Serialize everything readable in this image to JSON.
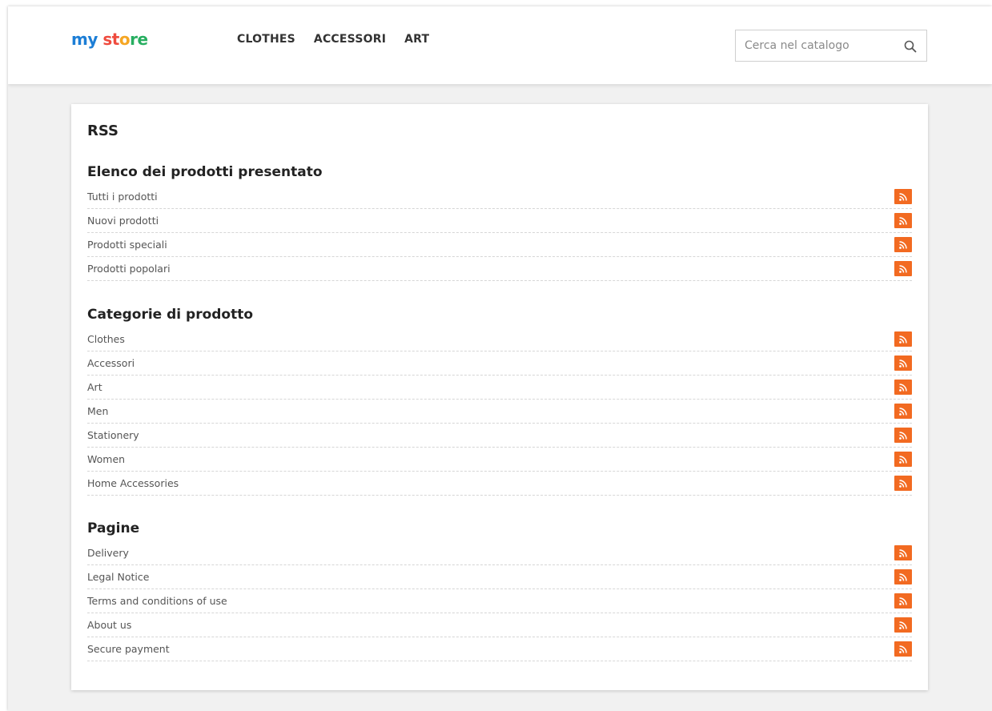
{
  "header": {
    "logo_parts": [
      "my",
      " ",
      "st",
      "o",
      "re"
    ],
    "nav": [
      "CLOTHES",
      "ACCESSORI",
      "ART"
    ],
    "search": {
      "placeholder": "Cerca nel catalogo",
      "icon": "search-icon"
    }
  },
  "page": {
    "title": "RSS",
    "sections": [
      {
        "title": "Elenco dei prodotti presentato",
        "items": [
          "Tutti i prodotti",
          "Nuovi prodotti",
          "Prodotti speciali",
          "Prodotti popolari"
        ]
      },
      {
        "title": "Categorie di prodotto",
        "items": [
          "Clothes",
          "Accessori",
          "Art",
          "Men",
          "Stationery",
          "Women",
          "Home Accessories"
        ]
      },
      {
        "title": "Pagine",
        "items": [
          "Delivery",
          "Legal Notice",
          "Terms and conditions of use",
          "About us",
          "Secure payment"
        ]
      }
    ]
  },
  "colors": {
    "rss_button": "#f26a21",
    "page_bg": "#f1f1f1",
    "card_bg": "#ffffff"
  },
  "icons": {
    "feed": "rss-icon",
    "search": "search-icon"
  }
}
